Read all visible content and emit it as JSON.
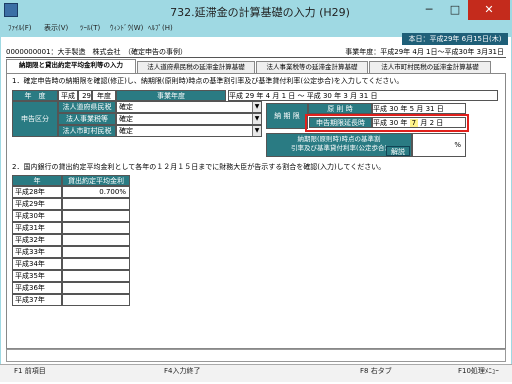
{
  "window": {
    "title": "732.延滞金の計算基礎の入力 (H29)",
    "minimize": "─",
    "maximize": "□",
    "close": "✕"
  },
  "menu": [
    "ﾌｧｲﾙ(F)",
    "表示(V)",
    "ﾂｰﾙ(T)",
    "ｳｨﾝﾄﾞｳ(W)",
    "ﾍﾙﾌﾟ(H)"
  ],
  "header": {
    "today": "本日：平成29年 6月15日(木)",
    "company": "0000000001：大手製造　株式会社　（確定申告の事例）",
    "fiscal_year": "事業年度：平成29年 4月 1日～平成30年 3月31日"
  },
  "tabs": [
    "納期限と貸出約定平均金利等の入力",
    "法人道府県民税の延滞金計算基礎",
    "法人事業税等の延滞金計算基礎",
    "法人市町村民税の延滞金計算基礎"
  ],
  "section1": {
    "title": "1．確定申告時の納期限を確認(修正)し、納期限(原則時)時点の基準割引率及び基準貸付利率(公定歩合)を入力してください。",
    "nendo_label": "年　度",
    "nendo_era": "平成",
    "nendo_value": "29",
    "nendo_unit": "年度",
    "jigyo_label": "事業年度",
    "jigyo_range": [
      "平成",
      "29",
      "年",
      "4",
      "月",
      "1",
      "日",
      "～",
      "平成",
      "30",
      "年",
      "3",
      "月",
      "31",
      "日"
    ],
    "shinkoku_label": "申告区分",
    "rows": [
      {
        "label": "法人道府県民税",
        "value": "確定"
      },
      {
        "label": "法人事業税等",
        "value": "確定"
      },
      {
        "label": "法人市町村民税",
        "value": "確定"
      }
    ],
    "noki_label": "納 期 限",
    "gensoku_label": "原 則 時",
    "gensoku_date": [
      "平成",
      "30",
      "年",
      "5",
      "月",
      "31",
      "日"
    ],
    "encho_label": "申告期限延長時",
    "encho_date": [
      "平成",
      "30",
      "年",
      "7",
      "月",
      "2",
      "日"
    ],
    "rate_label_1": "納期限(原則時)時点の基準割",
    "rate_label_2": "引率及び基準貸付利率(公定歩合)",
    "rate_unit": "%",
    "kaisetsu": "解説"
  },
  "section2": {
    "title": "2．国内銀行の貸出約定平均金利として各年の１２月１５日までに財務大臣が告示する割合を確認(入力)してください。",
    "col_year": "年",
    "col_rate": "貸出約定平均金利",
    "rows": [
      {
        "year": "平成28年",
        "rate": "0.700%"
      },
      {
        "year": "平成29年",
        "rate": ""
      },
      {
        "year": "平成30年",
        "rate": ""
      },
      {
        "year": "平成31年",
        "rate": ""
      },
      {
        "year": "平成32年",
        "rate": ""
      },
      {
        "year": "平成33年",
        "rate": ""
      },
      {
        "year": "平成34年",
        "rate": ""
      },
      {
        "year": "平成35年",
        "rate": ""
      },
      {
        "year": "平成36年",
        "rate": ""
      },
      {
        "year": "平成37年",
        "rate": ""
      }
    ]
  },
  "fkeys": {
    "f1": "F1 前項目",
    "f4": "F4入力終了",
    "f8": "F8 右タブ",
    "f10": "F10処理ﾒﾆｭｰ"
  }
}
